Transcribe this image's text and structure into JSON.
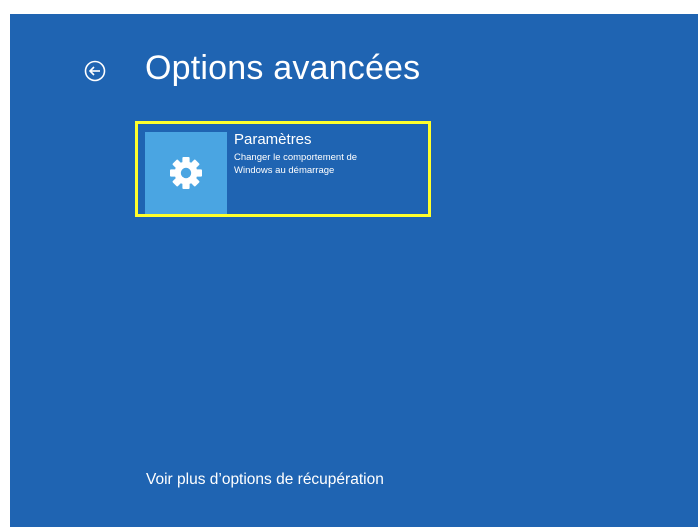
{
  "page": {
    "title": "Options avancées"
  },
  "back": {
    "icon": "back-arrow-circle-icon"
  },
  "options": [
    {
      "icon": "gear-icon",
      "title": "Paramètres",
      "description": "Changer le comportement de Windows au démarrage",
      "selected": true
    }
  ],
  "footer": {
    "more_options_link": "Voir plus d’options de récupération"
  },
  "colors": {
    "background": "#1f64b2",
    "tile_icon_background": "#4aa5e2",
    "selection_outline": "#ffff2b",
    "text": "#ffffff"
  }
}
